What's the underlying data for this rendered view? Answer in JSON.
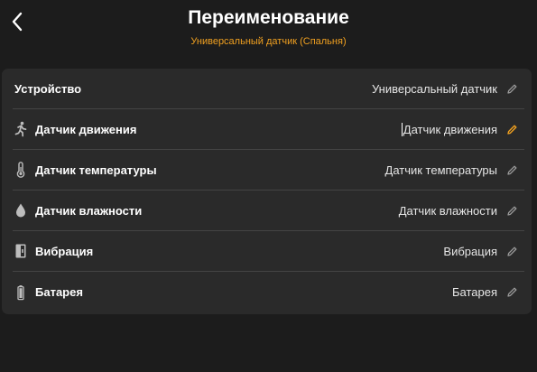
{
  "header": {
    "title": "Переименование",
    "subtitle": "Универсальный датчик (Спальня)"
  },
  "colors": {
    "accent": "#f0a020",
    "background": "#1c1c1c",
    "card": "#2a2a2a",
    "divider": "#444444"
  },
  "rows": [
    {
      "label": "Устройство",
      "value": "Универсальный датчик",
      "icon": "none",
      "editing": false
    },
    {
      "label": "Датчик движения",
      "value": "Датчик движения",
      "icon": "motion-icon",
      "editing": true
    },
    {
      "label": "Датчик температуры",
      "value": "Датчик температуры",
      "icon": "thermometer-icon",
      "editing": false
    },
    {
      "label": "Датчик влажности",
      "value": "Датчик влажности",
      "icon": "droplet-icon",
      "editing": false
    },
    {
      "label": "Вибрация",
      "value": "Вибрация",
      "icon": "vibration-icon",
      "editing": false
    },
    {
      "label": "Батарея",
      "value": "Батарея",
      "icon": "battery-icon",
      "editing": false
    }
  ]
}
